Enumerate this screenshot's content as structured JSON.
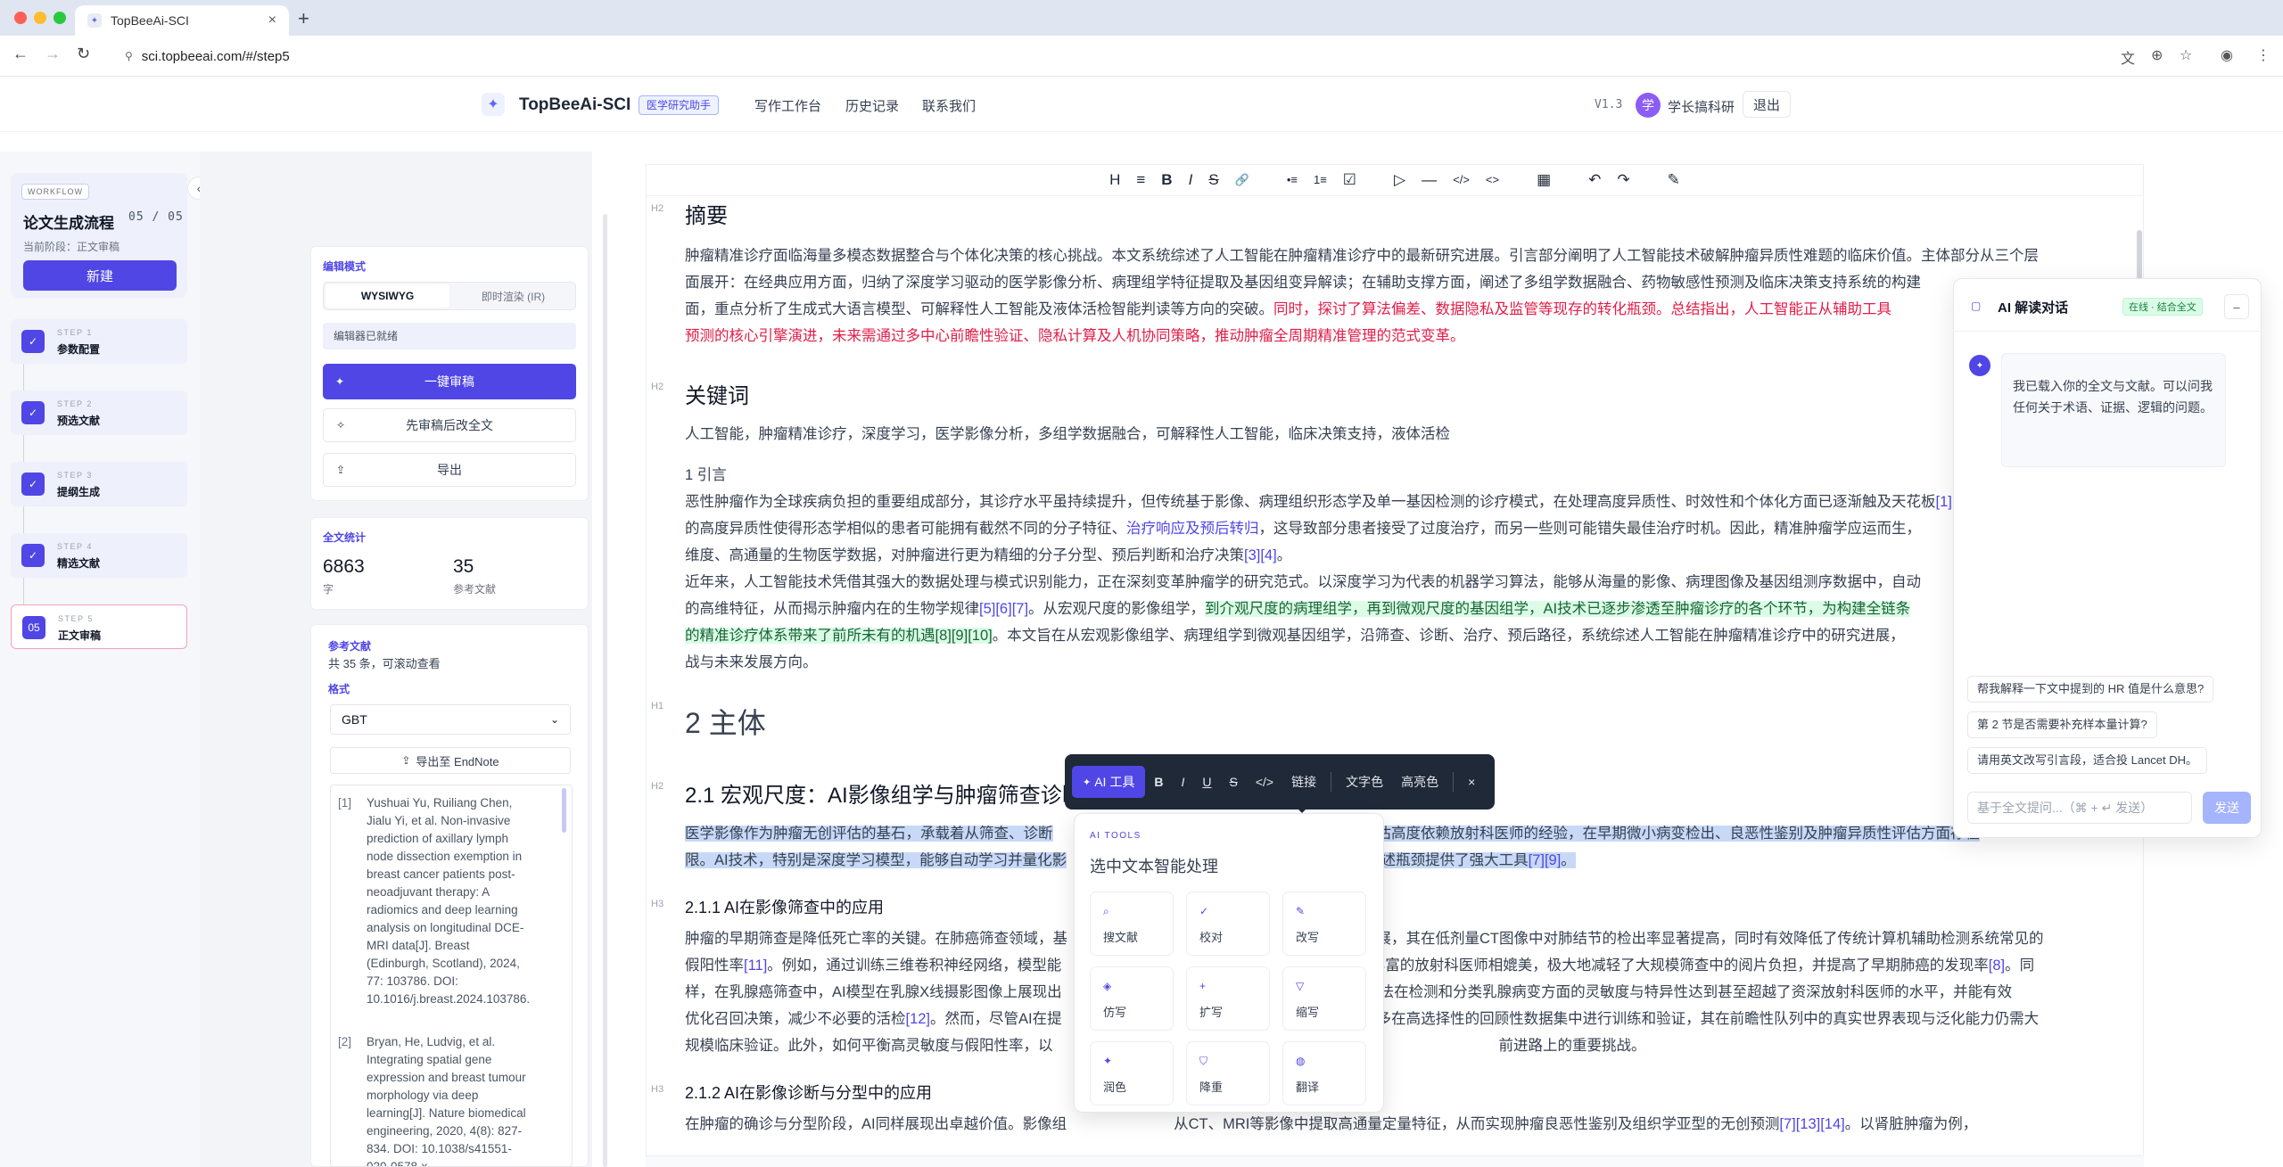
{
  "browser": {
    "tab_title": "TopBeeAi-SCI",
    "url": "sci.topbeeai.com/#/step5",
    "colors": {
      "close": "#ff5f57",
      "min": "#febc2e",
      "max": "#28c840"
    }
  },
  "header": {
    "brand": "TopBeeAi-SCI",
    "badge": "医学研究助手",
    "nav": [
      "写作工作台",
      "历史记录",
      "联系我们"
    ],
    "version": "V1.3",
    "avatar_letter": "学",
    "username": "学长搞科研",
    "logout": "退出"
  },
  "workflow": {
    "tag": "WORKFLOW",
    "title": "论文生成流程",
    "count": "05 / 05",
    "stage": "当前阶段：正文审稿",
    "new_label": "新建",
    "steps": [
      {
        "num": "STEP 1",
        "title": "参数配置",
        "mark": "✓"
      },
      {
        "num": "STEP 2",
        "title": "预选文献",
        "mark": "✓"
      },
      {
        "num": "STEP 3",
        "title": "提纲生成",
        "mark": "✓"
      },
      {
        "num": "STEP 4",
        "title": "精选文献",
        "mark": "✓"
      },
      {
        "num": "STEP 5",
        "title": "正文审稿",
        "mark": "05"
      }
    ]
  },
  "edit_panel": {
    "title": "编辑模式",
    "mode_wysiwyg": "WYSIWYG",
    "mode_ir": "即时渲染 (IR)",
    "ready": "编辑器已就绪",
    "review_all": "一键审稿",
    "review_then_edit": "先审稿后改全文",
    "export": "导出"
  },
  "stats": {
    "title": "全文统计",
    "chars": "6863",
    "chars_label": "字",
    "refs": "35",
    "refs_label": "参考文献"
  },
  "refs_panel": {
    "title": "参考文献",
    "summary": "共 35 条，可滚动查看",
    "format_label": "格式",
    "format_value": "GBT",
    "endnote": "导出至 EndNote",
    "items": [
      {
        "n": "[1]",
        "lines": [
          "Yushuai Yu, Ruiliang Chen,",
          "Jialu Yi, et al. Non-invasive",
          "prediction of axillary lymph",
          "node dissection exemption in",
          "breast cancer patients post-",
          "neoadjuvant therapy: A",
          "radiomics and deep learning",
          "analysis on longitudinal DCE-",
          "MRI data[J]. Breast",
          "(Edinburgh, Scotland), 2024,",
          "77: 103786. DOI:",
          "10.1016/j.breast.2024.103786."
        ]
      },
      {
        "n": "[2]",
        "lines": [
          "Bryan, He, Ludvig, et al.",
          "Integrating spatial gene",
          "expression and breast tumour",
          "morphology via deep",
          "learning[J]. Nature biomedical",
          "engineering, 2020, 4(8): 827-",
          "834. DOI: 10.1038/s41551-",
          "020-0578-x."
        ]
      }
    ]
  },
  "toolbar": {
    "icons": [
      "H",
      "≡",
      "B",
      "I",
      "S",
      "🔗",
      "•≡",
      "1≡",
      "☑",
      "▷",
      "—",
      "</>",
      "<>",
      "▦",
      "↶",
      "↷",
      "✎"
    ]
  },
  "doc": {
    "abstract_title": "摘要",
    "abstract_lines": [
      [
        "肿瘤精准诊疗面临海量多模态数据整合与个体化决策的核心挑战。本文系统综述了人工智能在肿瘤精准诊疗中的最新研究进展。引言部分阐明了人工智能技术破解肿瘤异质性难题的临床价值。主体部分从三个层"
      ],
      [
        "面展开：在经典应用方面，归纳了深度学习驱动的医学影像分析、病理组学特征提取及基因组变异解读；在辅助支撑方面，阐述了多组学数据融合、药物敏感性预测及临床决策支持系统的构建"
      ],
      [
        "面，重点分析了生成式大语言模型、可解释性人工智能及液体活检智能判读等方向的突破。",
        "同时，探讨了算法偏差、数据隐私及监管等现存的转化瓶颈。总结指出，人工智能正从辅助工具"
      ],
      [
        "预测的核心引擎演进，未来需通过多中心前瞻性验证、隐私计算及人机协同策略，推动肿瘤全周期精准管理的范式变革。"
      ]
    ],
    "keywords_title": "关键词",
    "keywords": "人工智能，肿瘤精准诊疗，深度学习，医学影像分析，多组学数据融合，可解释性人工智能，临床决策支持，液体活检",
    "intro_title": "1 引言",
    "intro": {
      "l1": "恶性肿瘤作为全球疾病负担的重要组成部分，其诊疗水平虽持续提升，但传统基于影像、病理组织形态学及单一基因检测的诊疗模式，在处理高度异质性、时效性和个体化方面已逐渐触及天花板",
      "l1c": "[1][2]",
      "l2a": "的高度异质性使得形态学相似的患者可能拥有截然不同的分子特征、",
      "l2b": "治疗响应及预后转归",
      "l2c": "，这导致部分患者接受了过度治疗，而另一些则可能错失最佳治疗时机。因此，精准肿瘤学应运而生，",
      "l3a": "维度、高通量的生物医学数据，对肿瘤进行更为精细的分子分型、预后判断和治疗决策",
      "l3c": "[3][4]",
      "l3d": "。",
      "l4": "近年来，人工智能技术凭借其强大的数据处理与模式识别能力，正在深刻变革肿瘤学的研究范式。以深度学习为代表的机器学习算法，能够从海量的影像、病理图像及基因组测序数据中，自动",
      "l5a": "的高维特征，从而揭示肿瘤内在的生物学规律",
      "l5c": "[5][6][7]",
      "l5d": "。从宏观尺度的影像组学，",
      "l5e": "到介观尺度的病理组学，再到微观尺度的基因组学，AI技术已逐步渗透至肿瘤诊疗的各个环节，为构建全链条",
      "l6a": "的精准诊疗体系带来了前所未有的机遇",
      "l6c": "[8][9][10]",
      "l6d": "。本文旨在从宏观影像组学、病理组学到微观基因组学，沿筛查、诊断、治疗、预后路径，系统综述人工智能在肿瘤精准诊疗中的研究进展，",
      "l7": "战与未来发展方向。"
    },
    "main_title": "2 主体",
    "sec21": "2.1 宏观尺度：AI影像组学与肿瘤筛查诊断",
    "sel1a": "医学影像作为肿瘤无创评估的基石，承载着从筛查、诊断",
    "sel1b": "学评估高度依赖放射科医师的经验，在早期微小病变检出、良恶性鉴别及肿瘤异质性评估方面存在",
    "sel2a": "限。AI技术，特别是深度学习模型，能够自动学习并量化影",
    "sel2b": "上述瓶颈提供了强大工具",
    "sel2c": "[7][9]",
    "sel2d": "。",
    "sec211": "2.1.1 AI在影像筛查中的应用",
    "p211": [
      {
        "a": "肿瘤的早期筛查是降低死亡率的关键。在肺癌筛查领域，基",
        "b": "进展，其在低剂量CT图像中对肺结节的检出率显著提高，同时有效降低了传统计算机辅助检测系统常见的"
      },
      {
        "a": "假阳性率",
        "c": "[11]",
        "b": "。例如，通过训练三维卷积神经网络，模型能",
        "d": "验丰富的放射科医师相媲美，极大地减轻了大规模筛查中的阅片负担，并提高了早期肺癌的发现率",
        "e": "[8]",
        "f": "。同"
      },
      {
        "a": "样，在乳腺癌筛查中，AI模型在乳腺X线摄影图像上展现出",
        "b": "度学习算法在检测和分类乳腺病变方面的灵敏度与特异性达到甚至超越了资深放射科医师的水平，并能有效"
      },
      {
        "a": "优化召回决策，减少不必要的活检",
        "c": "[12]",
        "b": "。然而，尽管AI在提",
        "d": "型大多在高选择性的回顾性数据集中进行训练和验证，其在前瞻性队列中的真实世界表现与泛化能力仍需大"
      },
      {
        "a": "规模临床验证。此外，如何平衡高灵敏度与假阳性率，以",
        "b": "前进路上的重要挑战。"
      }
    ],
    "sec212": "2.1.2 AI在影像诊断与分型中的应用",
    "p212a": "在肿瘤的确诊与分型阶段，AI同样展现出卓越价值。影像组",
    "p212b": "从CT、MRI等影像中提取高通量定量特征，从而实现肿瘤良恶性鉴别及组织学亚型的无创预测",
    "p212c": "[7][13][14]",
    "p212d": "。以肾脏肿瘤为例，"
  },
  "float_toolbar": {
    "ai": "AI 工具",
    "items": [
      "B",
      "I",
      "U",
      "S",
      "</>",
      "链接",
      "文字色",
      "高亮色",
      "×"
    ]
  },
  "ai_tools": {
    "tag": "AI TOOLS",
    "title": "选中文本智能处理",
    "tiles": [
      {
        "icon": "search-icon",
        "glyph": "⌕",
        "label": "搜文献"
      },
      {
        "icon": "check-icon",
        "glyph": "✓",
        "label": "校对"
      },
      {
        "icon": "edit-icon",
        "glyph": "✎",
        "label": "改写"
      },
      {
        "icon": "layers-icon",
        "glyph": "◈",
        "label": "仿写"
      },
      {
        "icon": "plus-icon",
        "glyph": "+",
        "label": "扩写"
      },
      {
        "icon": "funnel-icon",
        "glyph": "▽",
        "label": "缩写"
      },
      {
        "icon": "sparkle-icon",
        "glyph": "✦",
        "label": "润色"
      },
      {
        "icon": "shield-icon",
        "glyph": "⛉",
        "label": "降重"
      },
      {
        "icon": "globe-icon",
        "glyph": "◍",
        "label": "翻译"
      }
    ]
  },
  "chat": {
    "title": "AI 解读对话",
    "status": "在线 · 结合全文",
    "greeting": "我已载入你的全文与文献。可以问我任何关于术语、证据、逻辑的问题。",
    "suggestions": [
      "帮我解释一下文中提到的 HR 值是什么意思?",
      "第 2 节是否需要补充样本量计算?",
      "请用英文改写引言段，适合投 Lancet DH。"
    ],
    "placeholder": "基于全文提问...（⌘ + ↵ 发送）",
    "send": "发送"
  }
}
